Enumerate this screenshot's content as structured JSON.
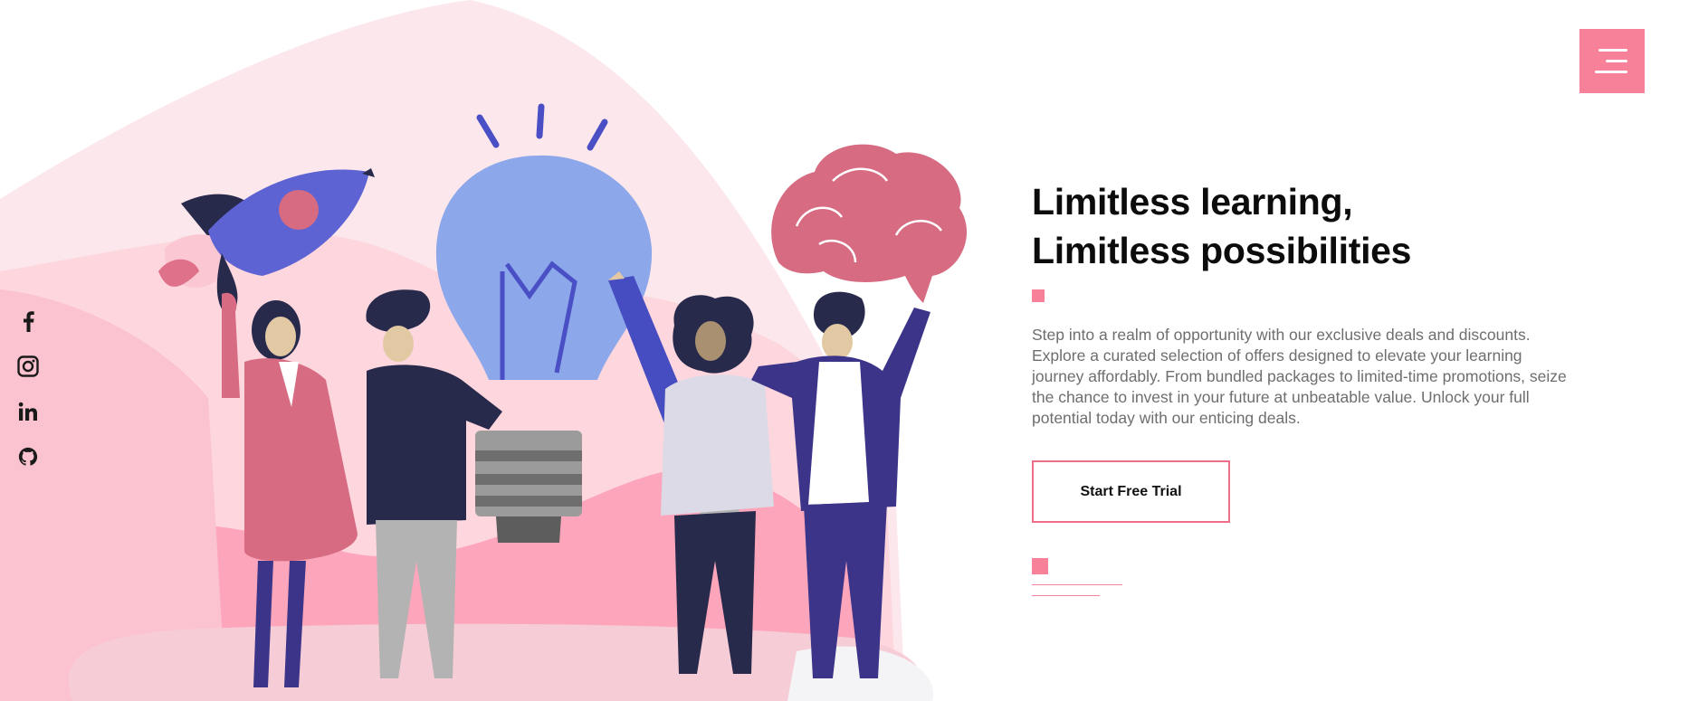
{
  "hero": {
    "heading_line1": "Limitless learning,",
    "heading_line2": "Limitless possibilities",
    "description": "Step into a realm of opportunity with our exclusive deals and discounts. Explore a curated selection of offers designed to elevate your learning journey affordably. From bundled packages to limited-time promotions, seize the chance to invest in your future at unbeatable value. Unlock your full potential today with our enticing deals.",
    "cta_label": "Start Free Trial"
  },
  "nav": {
    "menu_icon": "hamburger-menu-icon"
  },
  "socials": [
    {
      "name": "facebook",
      "icon": "facebook-icon"
    },
    {
      "name": "instagram",
      "icon": "instagram-icon"
    },
    {
      "name": "linkedin",
      "icon": "linkedin-icon"
    },
    {
      "name": "github",
      "icon": "github-icon"
    }
  ],
  "colors": {
    "accent": "#f78199",
    "heading": "#0c0c0c",
    "body_text": "#6e6e6e",
    "illustration_blue": "#5d63d3",
    "illustration_navy": "#282a4b",
    "illustration_pink": "#d66b82"
  }
}
